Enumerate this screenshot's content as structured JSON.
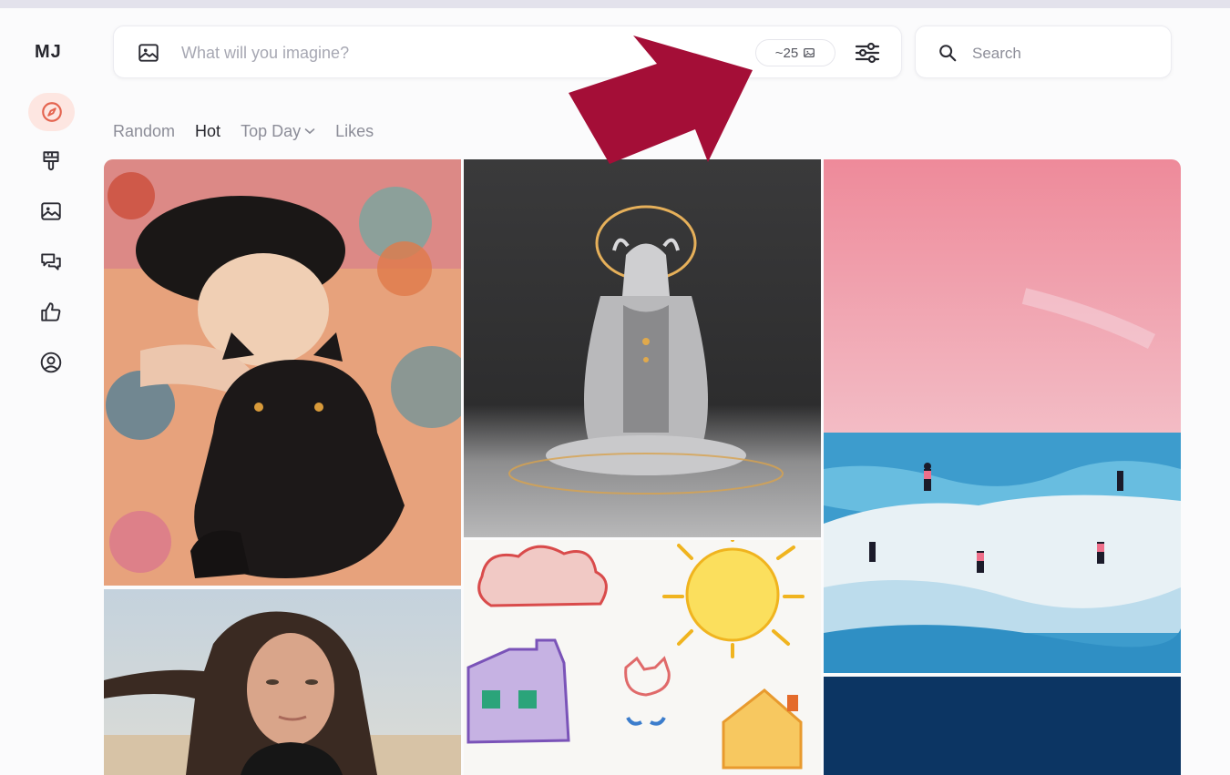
{
  "app": {
    "logo": "MJ",
    "colors": {
      "accent": "#e4644f",
      "annotation_arrow": "#a40e37",
      "navy_tile": "#0c3563"
    }
  },
  "sidebar": {
    "items": [
      {
        "name": "explore",
        "icon": "compass-icon",
        "active": true
      },
      {
        "name": "create",
        "icon": "paintbrush-icon",
        "active": false
      },
      {
        "name": "organize",
        "icon": "image-icon",
        "active": false
      },
      {
        "name": "chat",
        "icon": "chat-bubbles-icon",
        "active": false
      },
      {
        "name": "likes",
        "icon": "thumbs-up-icon",
        "active": false
      },
      {
        "name": "profile",
        "icon": "user-circle-icon",
        "active": false
      }
    ]
  },
  "prompt": {
    "placeholder": "What will you imagine?",
    "value": "",
    "credits_label": "~25",
    "credits_icon": "image-stack-icon",
    "settings_icon": "sliders-icon"
  },
  "search": {
    "placeholder": "Search",
    "value": ""
  },
  "filters": {
    "tabs": [
      {
        "label": "Random",
        "active": false
      },
      {
        "label": "Hot",
        "active": true
      },
      {
        "label": "Top Day",
        "active": false,
        "dropdown": true
      },
      {
        "label": "Likes",
        "active": false
      }
    ]
  },
  "gallery": {
    "images": [
      {
        "subject": "woman sleeping with black cat, patterned kimono illustration"
      },
      {
        "subject": "silver horned figure with golden halo sitting cross-legged"
      },
      {
        "subject": "pink sky over ocean waves with surfers, impasto painting"
      },
      {
        "subject": "portrait of woman with long dark windblown hair"
      },
      {
        "subject": "child's crayon drawing of cloud, sun, houses and cat"
      },
      {
        "subject": "solid navy blue image"
      }
    ]
  }
}
